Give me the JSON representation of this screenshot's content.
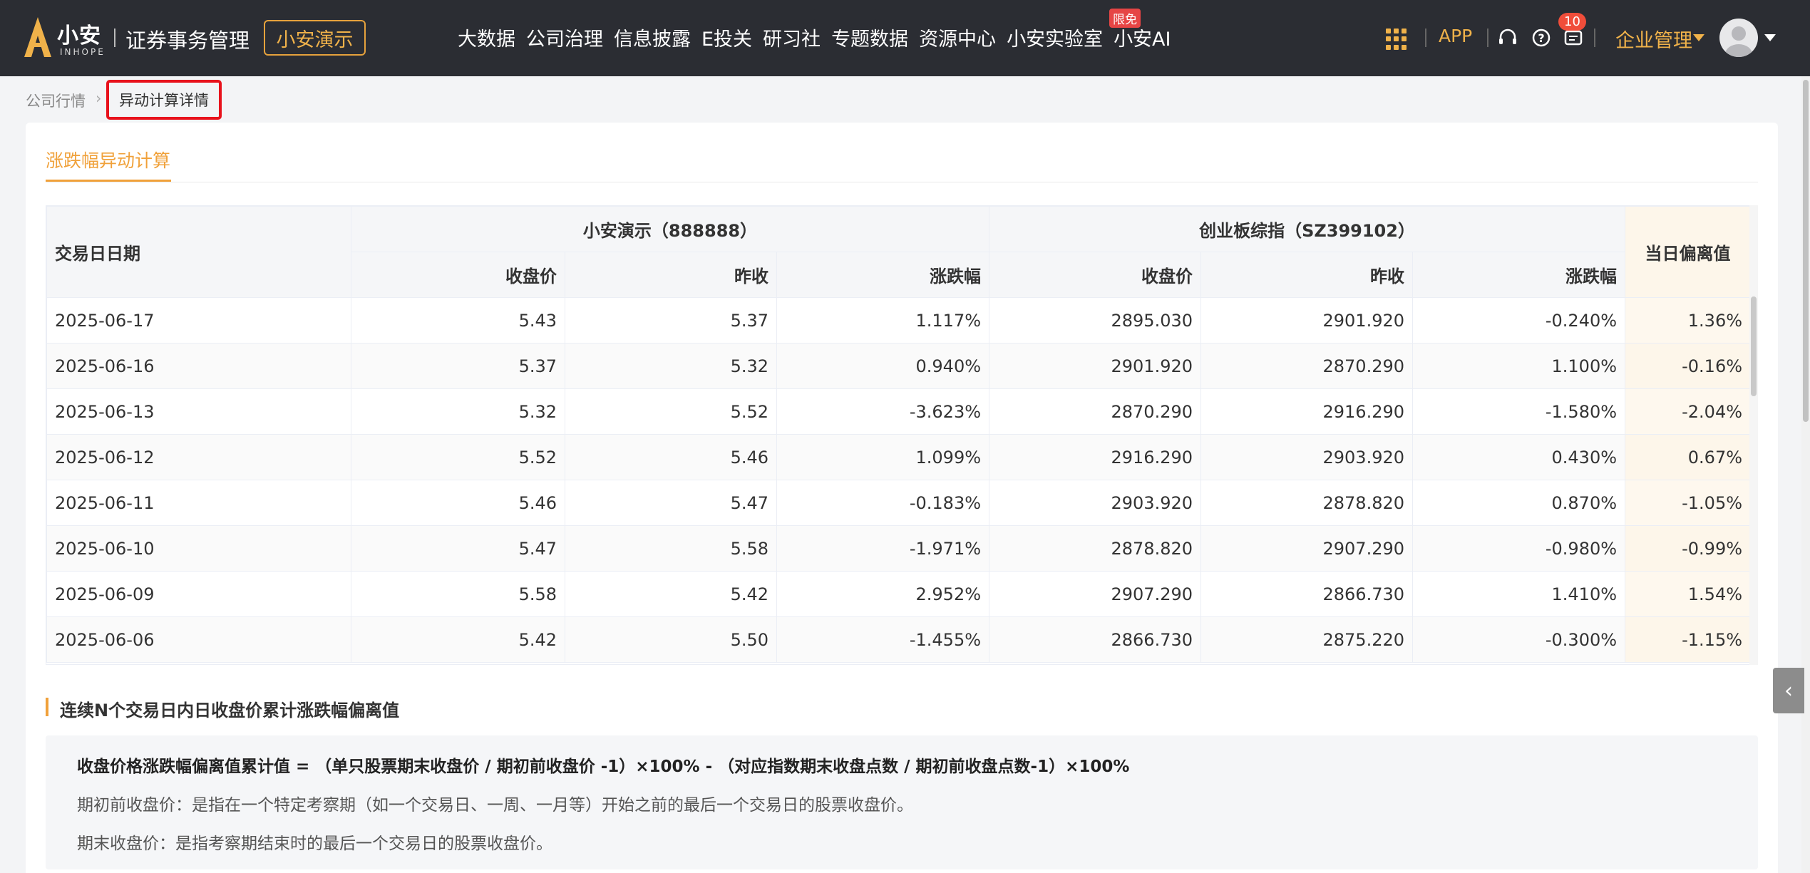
{
  "header": {
    "brand": "小安",
    "brand_sub": "INHOPE",
    "app_name": "证券事务管理",
    "company": "小安演示",
    "nav": [
      "大数据",
      "公司治理",
      "信息披露",
      "E投关",
      "研习社",
      "专题数据",
      "资源中心",
      "小安实验室",
      "小安AI"
    ],
    "free_badge": "限免",
    "app_link": "APP",
    "notification_count": "10",
    "enterprise_menu": "企业管理",
    "accent_color": "#f0b24a"
  },
  "breadcrumb": {
    "parent": "公司行情",
    "current": "异动计算详情"
  },
  "tab": {
    "label": "涨跌幅异动计算"
  },
  "table": {
    "date_header": "交易日日期",
    "stock_group": "小安演示（888888）",
    "index_group": "创业板综指（SZ399102）",
    "deviation_header": "当日偏离值",
    "sub_headers": [
      "收盘价",
      "昨收",
      "涨跌幅",
      "收盘价",
      "昨收",
      "涨跌幅"
    ],
    "rows": [
      [
        "2025-06-17",
        "5.43",
        "5.37",
        "1.117%",
        "2895.030",
        "2901.920",
        "-0.240%",
        "1.36%"
      ],
      [
        "2025-06-16",
        "5.37",
        "5.32",
        "0.940%",
        "2901.920",
        "2870.290",
        "1.100%",
        "-0.16%"
      ],
      [
        "2025-06-13",
        "5.32",
        "5.52",
        "-3.623%",
        "2870.290",
        "2916.290",
        "-1.580%",
        "-2.04%"
      ],
      [
        "2025-06-12",
        "5.52",
        "5.46",
        "1.099%",
        "2916.290",
        "2903.920",
        "0.430%",
        "0.67%"
      ],
      [
        "2025-06-11",
        "5.46",
        "5.47",
        "-0.183%",
        "2903.920",
        "2878.820",
        "0.870%",
        "-1.05%"
      ],
      [
        "2025-06-10",
        "5.47",
        "5.58",
        "-1.971%",
        "2878.820",
        "2907.290",
        "-0.980%",
        "-0.99%"
      ],
      [
        "2025-06-09",
        "5.58",
        "5.42",
        "2.952%",
        "2907.290",
        "2866.730",
        "1.410%",
        "1.54%"
      ],
      [
        "2025-06-06",
        "5.42",
        "5.50",
        "-1.455%",
        "2866.730",
        "2875.220",
        "-0.300%",
        "-1.15%"
      ]
    ]
  },
  "section": {
    "title": "连续N个交易日内日收盘价累计涨跌幅偏离值",
    "formula": "收盘价格涨跌幅偏离值累计值 = （单只股票期末收盘价 / 期初前收盘价 -1）×100%  -  （对应指数期末收盘点数 / 期初前收盘点数-1）×100%",
    "desc1": "期初前收盘价：是指在一个特定考察期（如一个交易日、一周、一月等）开始之前的最后一个交易日的股票收盘价。",
    "desc2": "期末收盘价：是指考察期结束时的最后一个交易日的股票收盘价。"
  }
}
